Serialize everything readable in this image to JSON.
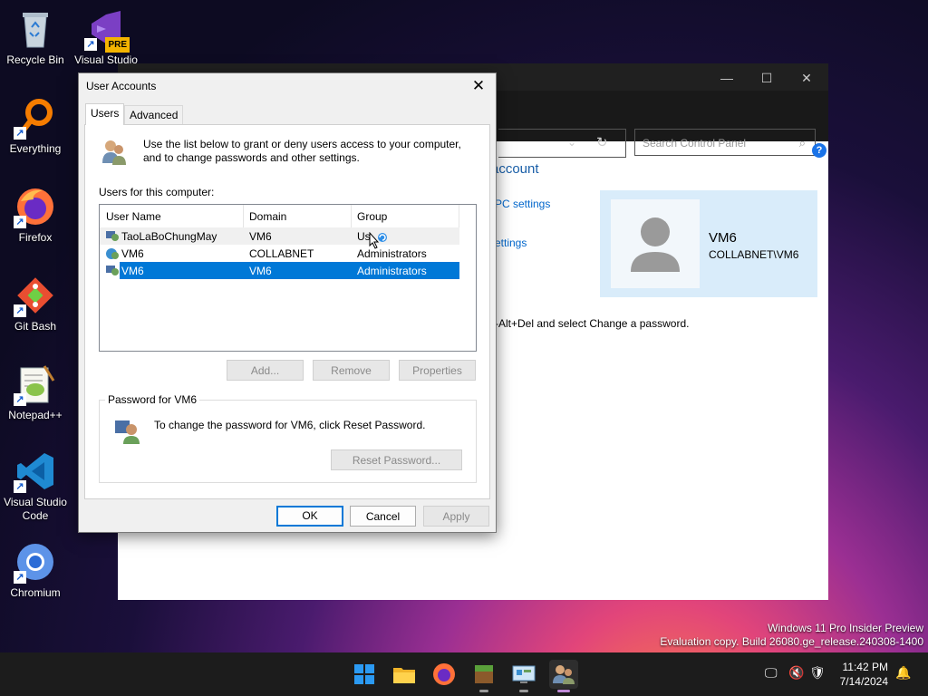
{
  "desktop": {
    "icons": [
      {
        "label": "Recycle Bin"
      },
      {
        "label": "Visual Studio 2022 P...",
        "badge": "PRE"
      },
      {
        "label": "Everything"
      },
      {
        "label": "Firefox"
      },
      {
        "label": "Git Bash"
      },
      {
        "label": "Notepad++"
      },
      {
        "label": "Visual Studio Code"
      },
      {
        "label": "Chromium"
      }
    ],
    "watermark": {
      "line1": "Windows 11 Pro Insider Preview",
      "line2": "Evaluation copy. Build 26080.ge_release.240308-1400"
    }
  },
  "control_panel": {
    "search_placeholder": "Search Control Panel",
    "heading": "account",
    "link1": "PC settings",
    "link2": "ettings",
    "card": {
      "name": "VM6",
      "domain": "COLLABNET\\VM6"
    },
    "ctrl_alt_del_text": "-Alt+Del and select Change a password.",
    "help": "?"
  },
  "dialog": {
    "title": "User Accounts",
    "close": "✕",
    "tabs": [
      "Users",
      "Advanced"
    ],
    "intro": "Use the list below to grant or deny users access to your computer, and to change passwords and other settings.",
    "list_label": "Users for this computer:",
    "columns": [
      "User Name",
      "Domain",
      "Group"
    ],
    "rows": [
      {
        "name": "TaoLaBoChungMay",
        "domain": "VM6",
        "group": "Us"
      },
      {
        "name": "VM6",
        "domain": "COLLABNET",
        "group": "Administrators"
      },
      {
        "name": "VM6",
        "domain": "VM6",
        "group": "Administrators"
      }
    ],
    "buttons": {
      "add": "Add...",
      "remove": "Remove",
      "properties": "Properties"
    },
    "password_group": {
      "legend": "Password for VM6",
      "text": "To change the password for VM6, click Reset Password.",
      "reset": "Reset Password..."
    },
    "footer": {
      "ok": "OK",
      "cancel": "Cancel",
      "apply": "Apply"
    }
  },
  "taskbar": {
    "clock_time": "11:42 PM",
    "clock_date": "7/14/2024"
  },
  "colors": {
    "accent": "#0078d7",
    "taskbar": "#1c1c1c"
  }
}
